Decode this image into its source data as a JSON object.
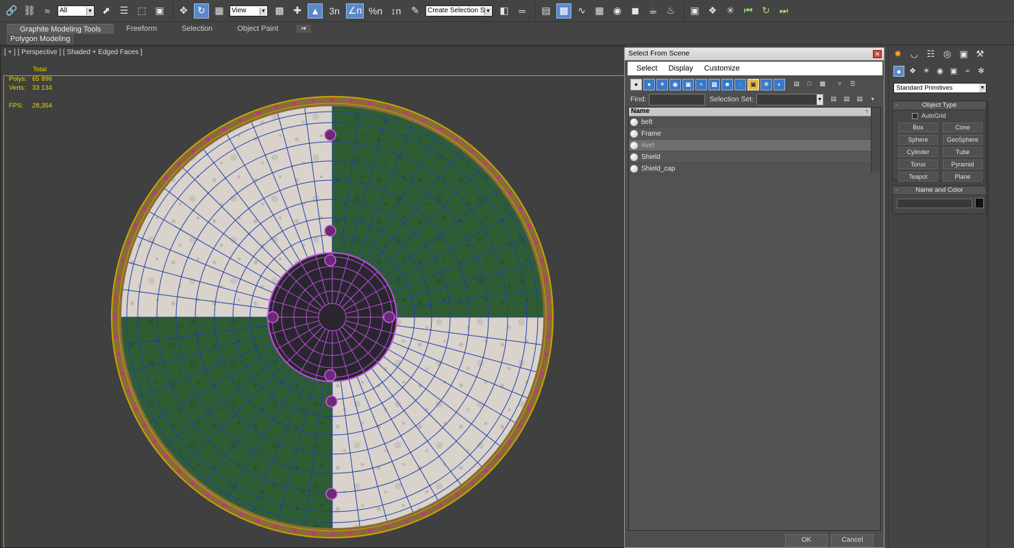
{
  "toolbar": {
    "selection_filter": "All",
    "reference_coord": "View",
    "named_selection": "Create Selection Se",
    "snap_labels": [
      "3n",
      "∠n",
      "%n",
      "↕n"
    ]
  },
  "ribbon": {
    "tabs": [
      "Graphite Modeling Tools",
      "Freeform",
      "Selection",
      "Object Paint"
    ],
    "options_glyph": "▪▾",
    "panel_label": "Polygon Modeling"
  },
  "viewport": {
    "label": "[ + ] [ Perspective ] [ Shaded + Edged Faces ]",
    "stats": {
      "header": "Total",
      "polys_label": "Polys:",
      "polys": "65 896",
      "verts_label": "Verts:",
      "verts": "33 134",
      "fps_label": "FPS:",
      "fps": "28,354"
    }
  },
  "dialog": {
    "title": "Select From Scene",
    "close_glyph": "✕",
    "menus": [
      "Select",
      "Display",
      "Customize"
    ],
    "find_label": "Find:",
    "find_value": "",
    "selset_label": "Selection Set:",
    "list_header": "Name",
    "sort_glyph": "↑",
    "items": [
      "belt",
      "Frame",
      "rivet",
      "Shield",
      "Shield_cap"
    ],
    "ok_label": "OK",
    "cancel_label": "Cancel",
    "toolbar_overflow_glyph": "▾"
  },
  "command_panel": {
    "category": "Standard Primitives",
    "object_type_title": "Object Type",
    "autogrid_label": "AutoGrid",
    "primitives": [
      "Box",
      "Cone",
      "Sphere",
      "GeoSphere",
      "Cylinder",
      "Tube",
      "Torus",
      "Pyramid",
      "Teapot",
      "Plane"
    ],
    "name_color_title": "Name and Color",
    "rollout_glyph": "-"
  },
  "colors": {
    "accent": "#5a88c8",
    "wireframe_selected": "#c050e0",
    "green_quarter": "#2f5d33",
    "white_quarter": "#d9d3cc",
    "rim_frame": "#c6a600"
  }
}
